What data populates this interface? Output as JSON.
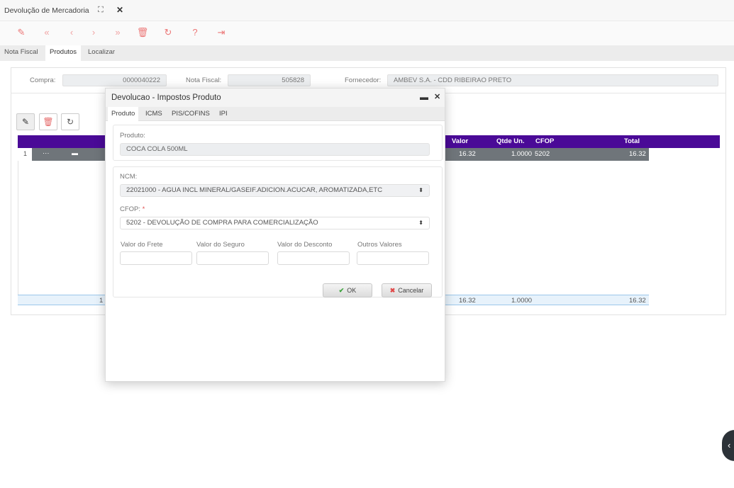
{
  "window": {
    "title": "Devolução de Mercadoria",
    "expand_icon": "expand-icon",
    "close_glyph": "✕"
  },
  "toolbar": {
    "icons": [
      "pencil-icon",
      "first-icon",
      "prev-icon",
      "next-icon",
      "last-icon",
      "trash-icon",
      "refresh-icon",
      "help-icon",
      "exit-icon"
    ]
  },
  "tabs": [
    "Nota Fiscal",
    "Produtos",
    "Localizar"
  ],
  "header": {
    "compra_label": "Compra:",
    "compra_value": "0000040222",
    "nota_label": "Nota Fiscal:",
    "nota_value": "505828",
    "fornecedor_label": "Fornecedor:",
    "fornecedor_value": "AMBEV S.A. - CDD RIBEIRAO PRETO"
  },
  "grid": {
    "columns": [
      "Valor",
      "Qtde Un.",
      "CFOP",
      "Total"
    ],
    "row": {
      "index": "1",
      "dots": "···",
      "valor": "16.32",
      "qtde": "1.0000",
      "cfop": "5202",
      "total": "16.32"
    },
    "footer": {
      "count": "1",
      "valor": "16.32",
      "qtde": "1.0000",
      "total": "16.32"
    }
  },
  "modal": {
    "title": "Devolucao - Impostos Produto",
    "minimize": "▬",
    "close": "✕",
    "tabs": [
      "Produto",
      "ICMS",
      "PIS/COFINS",
      "IPI"
    ],
    "produto_label": "Produto:",
    "produto_value": "COCA COLA 500ML",
    "ncm_label": "NCM:",
    "ncm_value": "22021000 - AGUA INCL MINERAL/GASEIF.ADICION.ACUCAR, AROMATIZADA,ETC",
    "cfop_label": "CFOP:",
    "cfop_required": "*",
    "cfop_value": "5202 - DEVOLUÇÃO DE COMPRA PARA COMERCIALIZAÇÃO",
    "frete_label": "Valor do Frete",
    "seguro_label": "Valor do Seguro",
    "desconto_label": "Valor do Desconto",
    "outros_label": "Outros Valores",
    "ok_label": "OK",
    "cancel_label": "Cancelar"
  }
}
